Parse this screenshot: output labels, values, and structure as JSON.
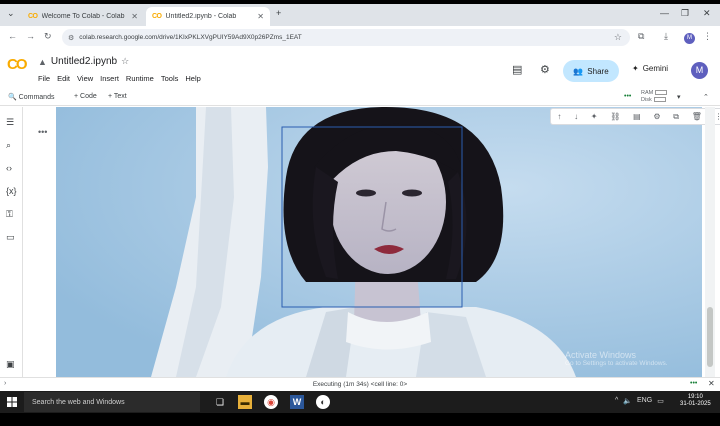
{
  "browser": {
    "tabs": [
      {
        "label": "Welcome To Colab - Colab",
        "active": false
      },
      {
        "label": "Untitled2.ipynb - Colab",
        "active": true
      }
    ],
    "url": "colab.research.google.com/drive/1KIxPKLXVgPUIY59Ad9X0p26PZms_1EAT",
    "profile_initial": "M"
  },
  "colab": {
    "logo": "CO",
    "notebook_title": "Untitled2.ipynb",
    "menu": [
      "File",
      "Edit",
      "View",
      "Insert",
      "Runtime",
      "Tools",
      "Help"
    ],
    "share_label": "Share",
    "gemini_label": "Gemini",
    "avatar_initial": "M"
  },
  "toolbar": {
    "commands_label": "Commands",
    "add_code_label": "+ Code",
    "add_text_label": "+ Text",
    "ram_label": "RAM",
    "disk_label": "Disk"
  },
  "cell": {
    "gutter_label": "•••"
  },
  "watermark": {
    "title": "Activate Windows",
    "subtitle": "Go to Settings to activate Windows."
  },
  "status": {
    "text": "Executing (1m 34s) <cell line: 0>"
  },
  "taskbar": {
    "search_placeholder": "Search the web and Windows",
    "tray_lang": "ENG",
    "time": "19:10",
    "date": "31-01-2025"
  },
  "colors": {
    "colab_orange": "#f9ab00",
    "share_bg": "#c2e7ff",
    "avatar": "#5e5fbe",
    "taskbar": "#1c1c1c"
  }
}
